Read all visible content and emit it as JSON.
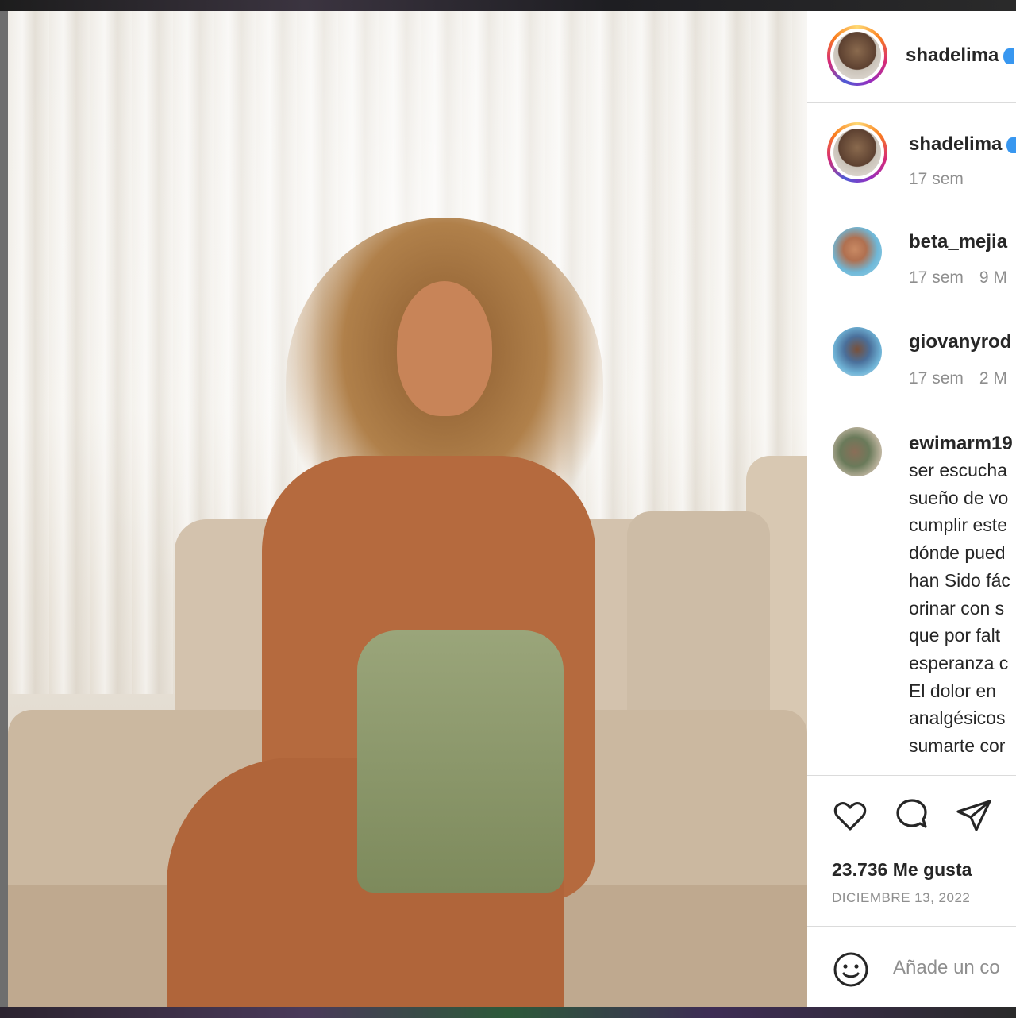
{
  "post": {
    "author": "shadelima",
    "author_verified": true,
    "likes_label": "23.736 Me gusta",
    "date_label": "DICIEMBRE 13, 2022"
  },
  "caption": {
    "username": "shadelima",
    "time": "17 sem"
  },
  "comments": [
    {
      "username": "beta_mejia",
      "time": "17 sem",
      "likes": "9 M"
    },
    {
      "username": "giovanyrod",
      "time": "17 sem",
      "likes": "2 M"
    },
    {
      "username": "ewimarm19",
      "lines": [
        "ser escucha",
        "sueño de vo",
        "cumplir este",
        "dónde pued",
        "han Sido fác",
        "orinar con s",
        "que por falt",
        "esperanza c",
        "El dolor en",
        "analgésicos",
        "sumarte cor"
      ]
    }
  ],
  "actions": {
    "like_icon": "heart-icon",
    "comment_icon": "speech-bubble-icon",
    "share_icon": "paper-plane-icon"
  },
  "add_comment": {
    "emoji_icon": "smiley-icon",
    "placeholder": "Añade un co"
  },
  "colors": {
    "verified": "#3897f0",
    "text": "#262626",
    "secondary": "#8e8e8e",
    "divider": "#dbdbdb"
  }
}
